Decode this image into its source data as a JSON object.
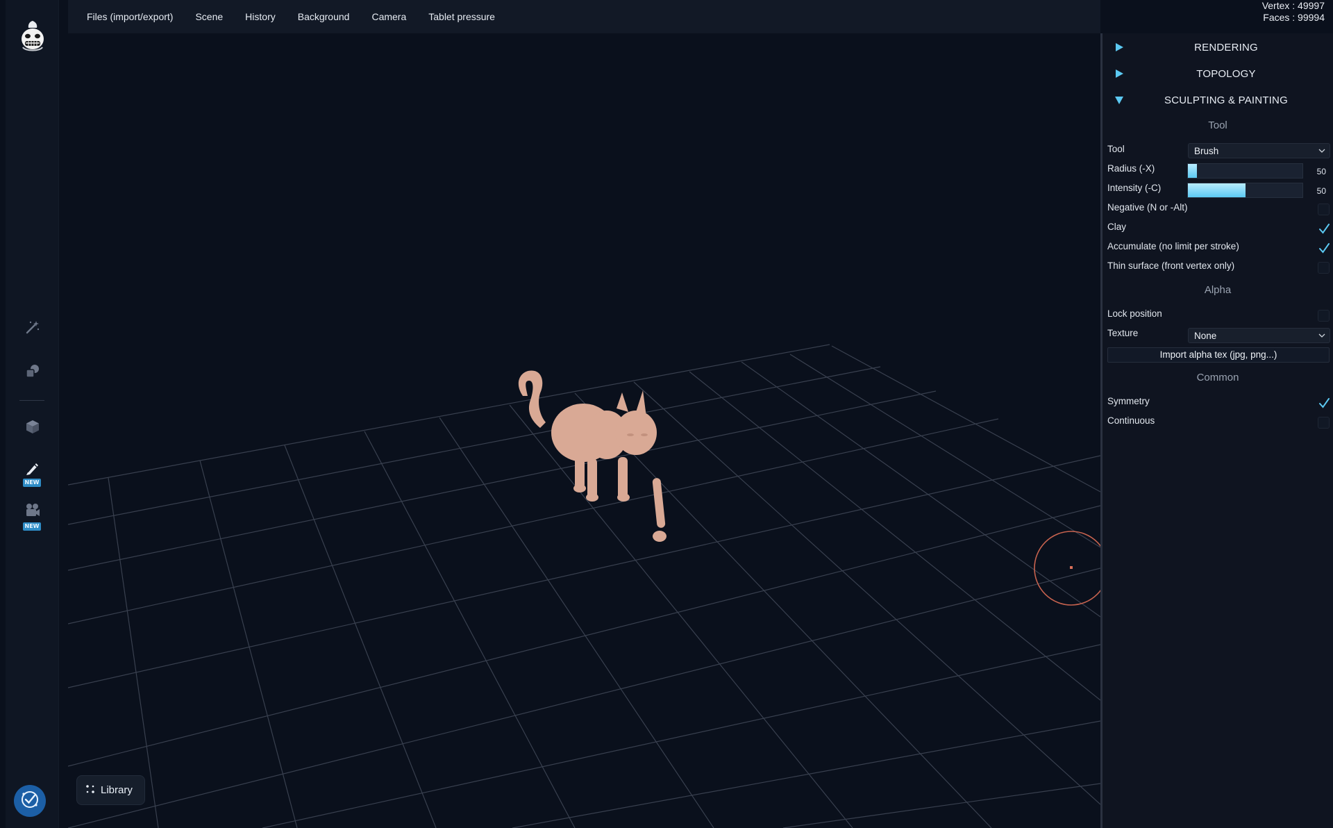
{
  "menubar": {
    "items": [
      "Files (import/export)",
      "Scene",
      "History",
      "Background",
      "Camera",
      "Tablet pressure"
    ]
  },
  "stats": {
    "vertex": "Vertex : 49997",
    "faces": "Faces : 99994"
  },
  "sidebar": {
    "tools": [
      {
        "icon": "magic-wand-icon"
      },
      {
        "icon": "shapes-icon"
      },
      {
        "icon": "cube-icon"
      },
      {
        "icon": "brush-icon",
        "badge": "NEW"
      },
      {
        "icon": "video-camera-icon",
        "badge": "NEW"
      }
    ],
    "help_icon": "help-icon"
  },
  "viewport": {
    "library_label": "Library",
    "model": "cat sculpture",
    "colors": {
      "background": "#0a101c",
      "grid": "#3a4252",
      "model": "#d6a491",
      "brush_cursor": "#d46f57"
    }
  },
  "panel": {
    "sections": [
      {
        "title": "RENDERING",
        "expanded": false
      },
      {
        "title": "TOPOLOGY",
        "expanded": false
      },
      {
        "title": "SCULPTING & PAINTING",
        "expanded": true
      }
    ],
    "tool_group": "Tool",
    "tool": {
      "label": "Tool",
      "value": "Brush"
    },
    "radius": {
      "label": "Radius (-X)",
      "value": "50",
      "fill": 0.08
    },
    "intensity": {
      "label": "Intensity (-C)",
      "value": "50",
      "fill": 0.5
    },
    "negative": {
      "label": "Negative (N or -Alt)",
      "checked": false
    },
    "clay": {
      "label": "Clay",
      "checked": true
    },
    "accumulate": {
      "label": "Accumulate (no limit per stroke)",
      "checked": true
    },
    "thin_surface": {
      "label": "Thin surface (front vertex only)",
      "checked": false
    },
    "alpha_group": "Alpha",
    "lock_position": {
      "label": "Lock position",
      "checked": false
    },
    "texture": {
      "label": "Texture",
      "value": "None"
    },
    "import_alpha": "Import alpha tex (jpg, png...)",
    "common_group": "Common",
    "symmetry": {
      "label": "Symmetry",
      "checked": true
    },
    "continuous": {
      "label": "Continuous",
      "checked": false
    },
    "accent": "#5cc9f2"
  }
}
